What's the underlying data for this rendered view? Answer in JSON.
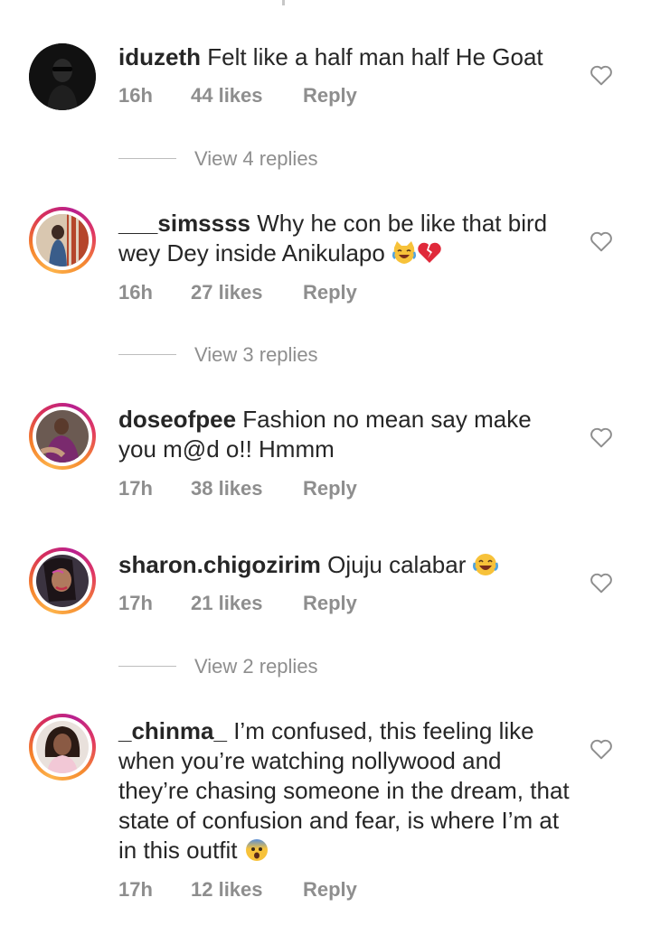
{
  "comments": [
    {
      "username": "iduzeth",
      "text": "Felt like a half man half He Goat",
      "time": "16h",
      "likes": "44 likes",
      "reply": "Reply",
      "view_replies": "View 4 replies",
      "avatar_ring": false
    },
    {
      "username": "___simssss",
      "text": "Why he con be like that bird wey Dey inside Anikulapo",
      "text_emojis": [
        "crying-laughing-cat",
        "broken-heart"
      ],
      "time": "16h",
      "likes": "27 likes",
      "reply": "Reply",
      "view_replies": "View 3 replies",
      "avatar_ring": true
    },
    {
      "username": "doseofpee",
      "text": "Fashion no mean say make you m@d o!! Hmmm",
      "time": "17h",
      "likes": "38 likes",
      "reply": "Reply",
      "avatar_ring": true
    },
    {
      "username": "sharon.chigozirim",
      "text": "Ojuju calabar",
      "text_emojis": [
        "tears-of-joy"
      ],
      "time": "17h",
      "likes": "21 likes",
      "reply": "Reply",
      "view_replies": "View 2 replies",
      "avatar_ring": true
    },
    {
      "username": "_chinma_",
      "text": "I’m confused, this feeling like when you’re watching nollywood and they’re chasing someone in the dream, that state of confusion and fear, is where I’m at in this outfit",
      "text_emojis": [
        "fearful-face"
      ],
      "time": "17h",
      "likes": "12 likes",
      "reply": "Reply",
      "avatar_ring": true
    }
  ],
  "colors": {
    "text": "#262626",
    "meta": "#8e8e8e",
    "ring_start": "#fdb34a",
    "ring_mid": "#d8305a",
    "ring_end": "#b81f8f"
  },
  "icons": {
    "like": "heart-outline-icon"
  }
}
